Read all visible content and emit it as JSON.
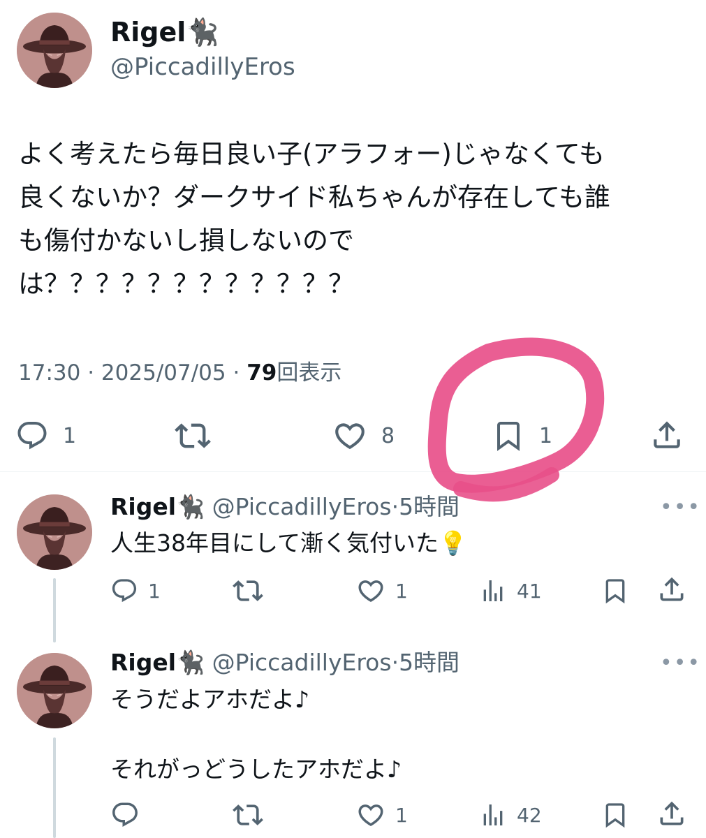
{
  "main_tweet": {
    "name": "Rigel",
    "name_emoji": "🐈‍⬛",
    "handle": "@PiccadillyEros",
    "text_lines": [
      "よく考えたら毎日良い子(アラフォー)じゃなくても",
      "良くないか？ダークサイド私ちゃんが存在しても誰",
      "も傷付かないし損しないので",
      "は？？？？？？？？？？？？"
    ],
    "time": "17:30",
    "date": "2025/07/05",
    "views": "79",
    "views_label": "回表示",
    "separator": "·",
    "reply_count": "1",
    "like_count": "8",
    "bookmark_count": "1"
  },
  "replies": [
    {
      "name": "Rigel",
      "name_emoji": "🐈‍⬛",
      "handle": "@PiccadillyEros",
      "time_ago": "5時間",
      "text_lines": [
        "人生38年目にして漸く気付いた💡"
      ],
      "reply_count": "1",
      "like_count": "1",
      "view_count": "41"
    },
    {
      "name": "Rigel",
      "name_emoji": "🐈‍⬛",
      "handle": "@PiccadillyEros",
      "time_ago": "5時間",
      "text_lines": [
        "そうだよアホだよ♪",
        "それがっどうしたアホだよ♪"
      ],
      "reply_count": "",
      "like_count": "1",
      "view_count": "42"
    }
  ],
  "icons": {
    "reply": "reply-icon",
    "retweet": "retweet-icon",
    "like": "heart-icon",
    "bookmark": "bookmark-icon",
    "share": "share-icon",
    "views": "views-icon",
    "more": "more-icon"
  },
  "colors": {
    "text": "#0f1419",
    "muted": "#536471",
    "highlight_marker": "#e8508a",
    "divider": "#eff3f4"
  }
}
